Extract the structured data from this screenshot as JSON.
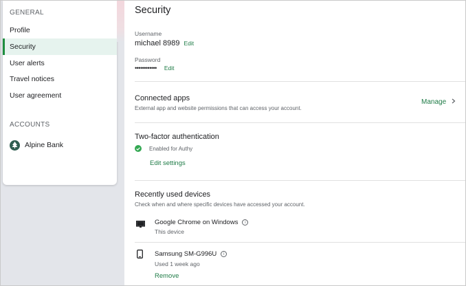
{
  "sidebar": {
    "general_label": "GENERAL",
    "items": [
      {
        "label": "Profile"
      },
      {
        "label": "Security"
      },
      {
        "label": "User alerts"
      },
      {
        "label": "Travel notices"
      },
      {
        "label": "User agreement"
      }
    ],
    "accounts_label": "ACCOUNTS",
    "bank": {
      "label": "Alpine Bank",
      "icon": "tree-icon"
    }
  },
  "main": {
    "title": "Security",
    "username": {
      "label": "Username",
      "value": "michael 8989",
      "edit": "Edit"
    },
    "password": {
      "label": "Password",
      "value": "••••••••••••",
      "edit": "Edit"
    },
    "connected_apps": {
      "title": "Connected apps",
      "description": "External app and website permissions that can access your account.",
      "manage": "Manage",
      "manage_icon": "chevron-right-icon"
    },
    "two_factor": {
      "title": "Two-factor authentication",
      "status": "Enabled for Authy",
      "status_icon": "check-circle-icon",
      "edit_settings": "Edit settings"
    },
    "devices": {
      "title": "Recently used devices",
      "description": "Check when and where specific devices have accessed your account.",
      "items": [
        {
          "name": "Google Chrome on Windows",
          "sub": "This device",
          "icon": "monitor-icon"
        },
        {
          "name": "Samsung SM-G996U",
          "sub": "Used 1 week ago",
          "icon": "phone-icon",
          "remove": "Remove"
        }
      ]
    }
  },
  "colors": {
    "accent": "#1e7b46",
    "active_bg": "#e6f3ee",
    "success": "#34a853"
  }
}
